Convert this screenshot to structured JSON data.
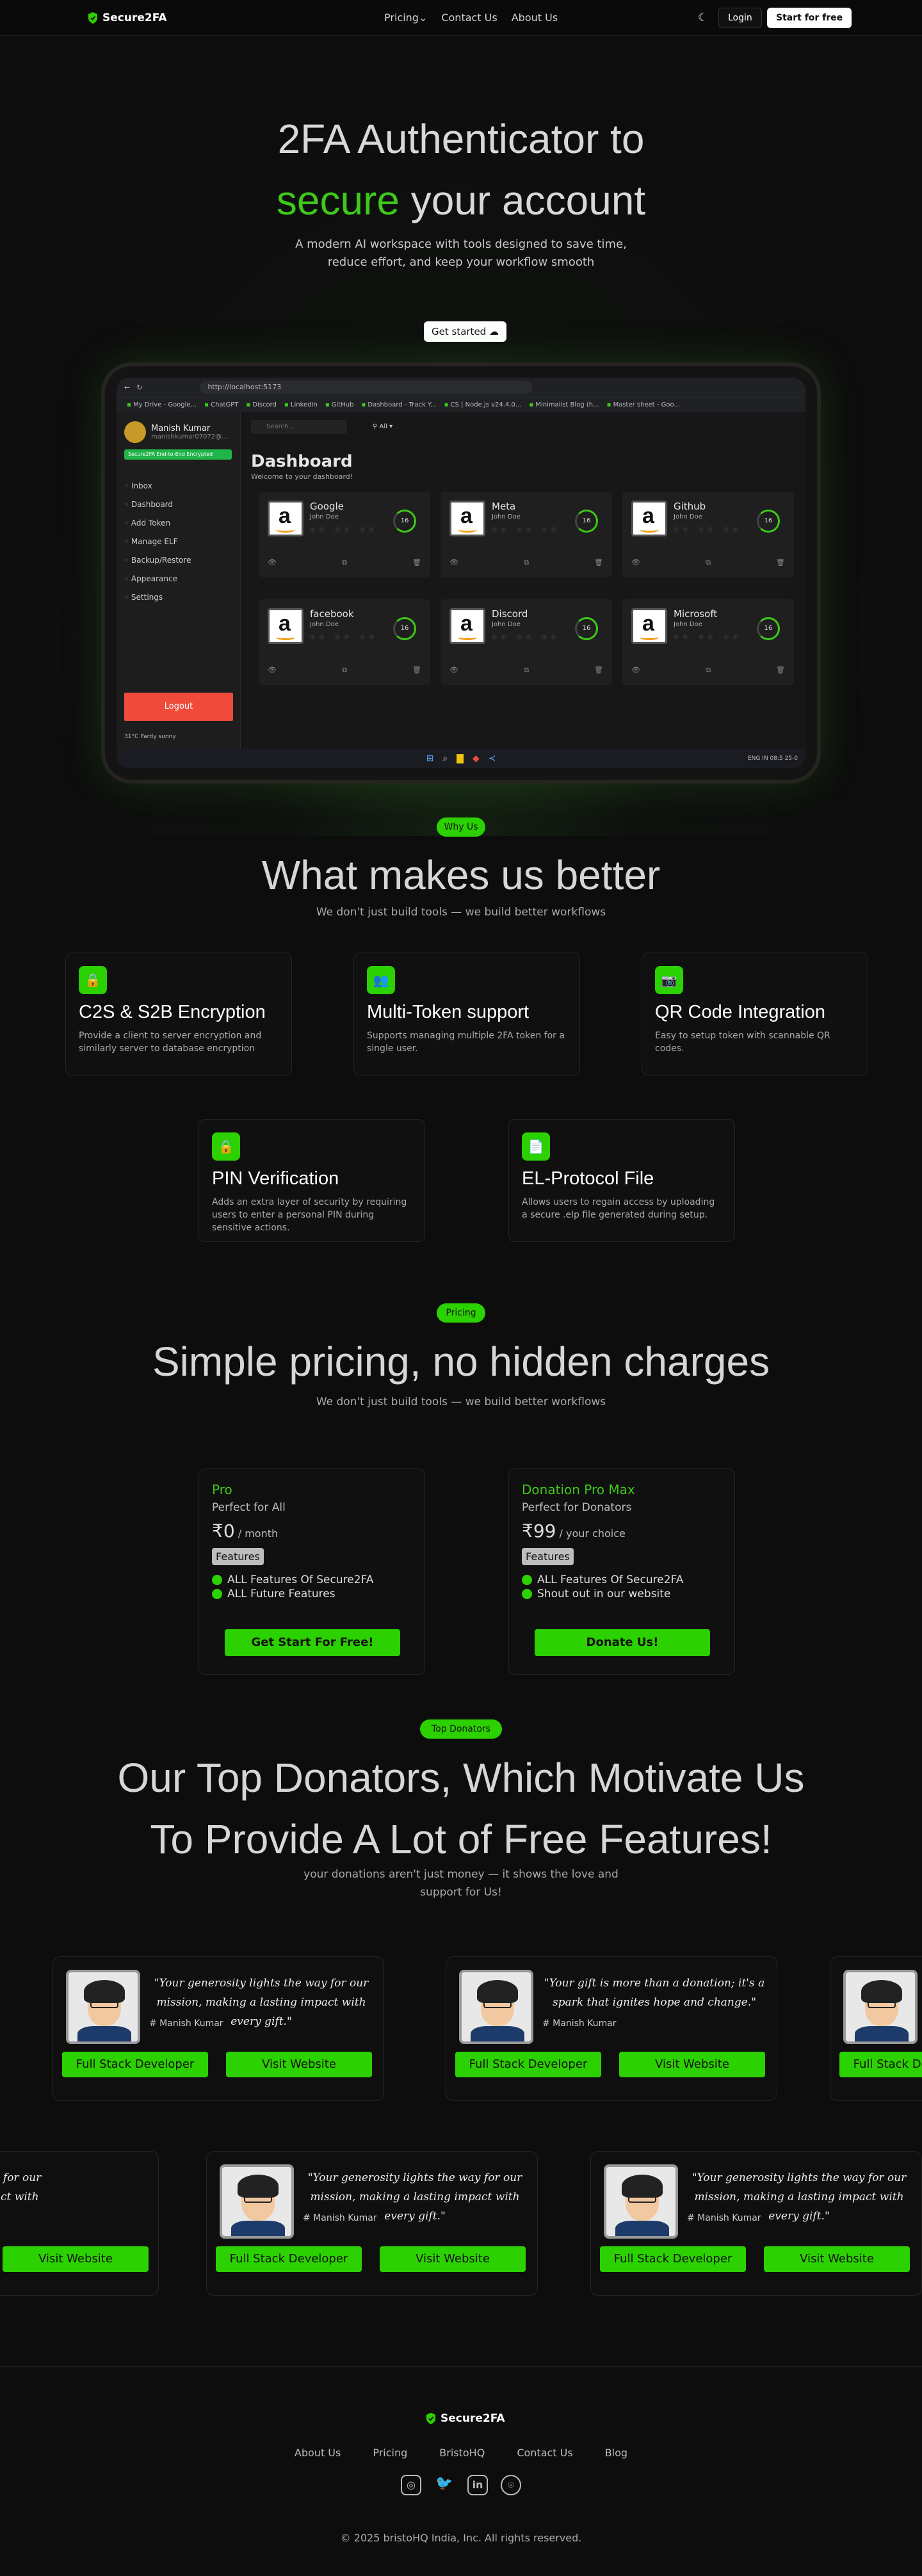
{
  "nav": {
    "brand": "Secure2FA",
    "links": [
      "Pricing",
      "Contact Us",
      "About Us"
    ],
    "login": "Login",
    "start": "Start for free"
  },
  "hero": {
    "line1": "2FA Authenticator to",
    "line2_green": "secure",
    "line2_rest": " your account",
    "subtitle": "A modern AI workspace with tools designed to save time, reduce effort, and keep your workflow smooth",
    "cta": "Get started"
  },
  "mockup": {
    "url": "http://localhost:5173",
    "bookmarks": [
      "My Drive - Google...",
      "ChatGPT",
      "Discord",
      "LinkedIn",
      "GitHub",
      "Dashboard - Track Y...",
      "CS | Node.js v24.4.0...",
      "Minimalist Blog (h...",
      "Master sheet - Goo..."
    ],
    "user_name": "Manish Kumar",
    "user_email": "manishkumar07072@...",
    "secure_bar": "Secure2FA End-to-End Encrypted",
    "menu": [
      "Inbox",
      "Dashboard",
      "Add Token",
      "Manage ELF",
      "Backup/Restore",
      "Appearance",
      "Settings"
    ],
    "logout": "Logout",
    "weather": "31°C Partly sunny",
    "search_placeholder": "Search...",
    "filter": "All",
    "dash_title": "Dashboard",
    "dash_sub": "Welcome to your dashboard!",
    "tokens": [
      {
        "name": "Google",
        "user": "John Doe",
        "timer": "16"
      },
      {
        "name": "Meta",
        "user": "John Doe",
        "timer": "16"
      },
      {
        "name": "Github",
        "user": "John Doe",
        "timer": "16"
      },
      {
        "name": "facebook",
        "user": "John Doe",
        "timer": "16"
      },
      {
        "name": "Discord",
        "user": "John Doe",
        "timer": "16"
      },
      {
        "name": "Microsoft",
        "user": "John Doe",
        "timer": "16"
      }
    ],
    "code_mask": "•• •• ••",
    "tray": "ENG IN",
    "clock": "08:5 25-0"
  },
  "features": {
    "pill": "Why Us",
    "title": "What makes us better",
    "subtitle": "We don't just build tools — we build better workflows",
    "cards": [
      {
        "title": "C2S & S2B Encryption",
        "desc": "Provide a client to server encryption and similarly server to database encryption"
      },
      {
        "title": "Multi-Token support",
        "desc": "Supports managing multiple 2FA token for a single user."
      },
      {
        "title": "QR Code Integration",
        "desc": "Easy to setup token with scannable QR codes."
      },
      {
        "title": "PIN Verification",
        "desc": "Adds an extra layer of security by requiring users to enter a personal PIN during sensitive actions."
      },
      {
        "title": "EL-Protocol File",
        "desc": "Allows users to regain access by uploading a secure .elp file generated during setup."
      }
    ]
  },
  "pricing": {
    "pill": "Pricing",
    "title": "Simple pricing, no hidden charges",
    "subtitle": "We don't just build tools — we build better workflows",
    "plans": [
      {
        "name": "Pro",
        "for": "Perfect for All",
        "price": "₹0",
        "period": " / month",
        "features_label": "Features",
        "items": [
          "ALL Features Of Secure2FA",
          "ALL Future Features"
        ],
        "cta": "Get Start For Free!"
      },
      {
        "name": "Donation Pro Max",
        "for": "Perfect for Donators",
        "price": "₹99",
        "period": " / your choice",
        "features_label": "Features",
        "items": [
          "ALL Features Of Secure2FA",
          "Shout out in our website"
        ],
        "cta": "Donate Us!"
      }
    ]
  },
  "donators": {
    "pill": "Top Donators",
    "title_line1": "Our Top Donators, Which Motivate Us",
    "title_line2": "To Provide A Lot of Free Features!",
    "subtitle": "your donations aren't just money — it shows the love and support for Us!",
    "quote_a": "\"Your generosity lights the way for our mission, making a lasting impact with every gift.\"",
    "quote_b": "\"Your gift is more than a donation; it's a spark that ignites hope and change.\"",
    "name": "# Manish Kumar",
    "role": "Full Stack Developer",
    "visit": "Visit Website"
  },
  "footer": {
    "brand": "Secure2FA",
    "links": [
      "About Us",
      "Pricing",
      "BristoHQ",
      "Contact Us",
      "Blog"
    ],
    "social": [
      "instagram-icon",
      "twitter-icon",
      "linkedin-icon",
      "github-icon"
    ],
    "copyright": "© 2025 bristoHQ India, Inc. All rights reserved."
  },
  "colors": {
    "accent": "#2bd100",
    "accent_text": "#3ec91a",
    "logout": "#ef4a3a",
    "background": "#0d0d0d"
  }
}
